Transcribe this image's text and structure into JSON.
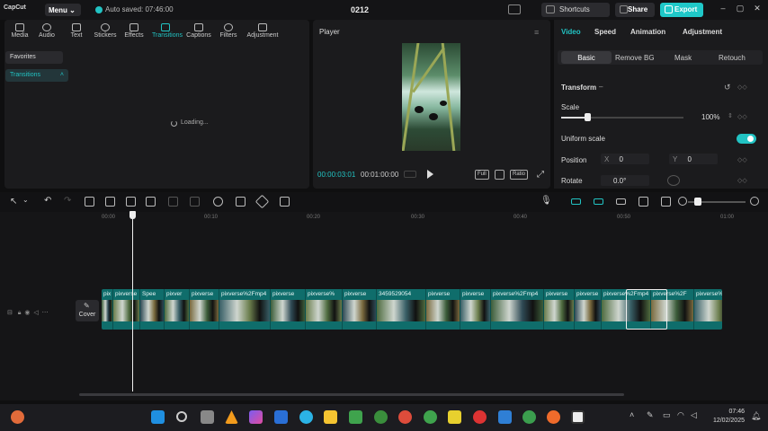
{
  "titlebar": {
    "logo": "CapCut",
    "menu_label": "Menu",
    "autosave": "Auto saved: 07:46:00",
    "project_name": "0212",
    "shortcuts_label": "Shortcuts",
    "share_label": "Share",
    "export_label": "Export"
  },
  "toolbar": {
    "items": [
      "Media",
      "Audio",
      "Text",
      "Stickers",
      "Effects",
      "Transitions",
      "Captions",
      "Filters",
      "Adjustment"
    ],
    "active": "Transitions"
  },
  "sidebar": {
    "favorites": "Favorites",
    "transitions": "Transitions"
  },
  "media": {
    "loading_text": "Loading..."
  },
  "player": {
    "title": "Player",
    "current_time": "00:00:03:01",
    "duration": "00:01:00:00",
    "full_label": "Full",
    "ratio_label": "Ratio"
  },
  "properties": {
    "tabs": [
      "Video",
      "Speed",
      "Animation",
      "Adjustment"
    ],
    "active_tab": "Video",
    "subtabs": [
      "Basic",
      "Remove BG",
      "Mask",
      "Retouch"
    ],
    "active_subtab": "Basic",
    "transform_label": "Transform",
    "scale_label": "Scale",
    "scale_value": "100%",
    "scale_fraction": 1.0,
    "uniform_scale_label": "Uniform scale",
    "uniform_scale_on": true,
    "position_label": "Position",
    "x_label": "X",
    "x_value": "0",
    "y_label": "Y",
    "y_value": "0",
    "rotate_label": "Rotate",
    "rotate_value": "0.0°"
  },
  "timeline": {
    "ruler": [
      "00:00",
      "00:10",
      "00:20",
      "00:30",
      "00:40",
      "00:50",
      "01:00"
    ],
    "cover_label": "Cover",
    "clips": [
      "pix",
      "pixverse",
      "Spee",
      "pixver",
      "pixverse",
      "pixverse%2Fmp4",
      "pixverse",
      "pixverse%",
      "pixverse",
      "3459529054",
      "pixverse",
      "pixverse",
      "pixverse%2Fmp4",
      "pixverse",
      "pixverse",
      "pixverse%2Fmp4",
      "pixverse%2F",
      "pixverse%2Fmp4"
    ]
  },
  "taskbar": {
    "time": "07:46",
    "date": "12/02/2025"
  },
  "colors": {
    "accent": "#22c3c3",
    "clip_track": "#0f6d6b",
    "background": "#0f0f10"
  }
}
